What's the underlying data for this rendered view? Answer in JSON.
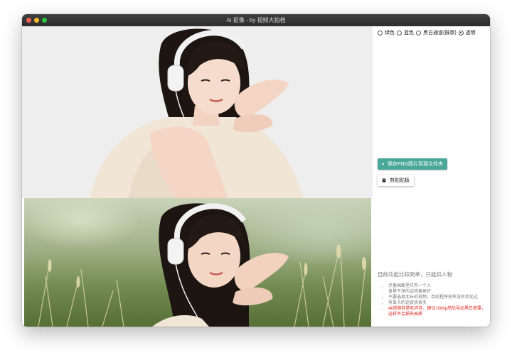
{
  "window": {
    "title": "Ai 抠像 - by 视频大拍档"
  },
  "options": {
    "background_choices": [
      {
        "label": "绿色",
        "selected": false
      },
      {
        "label": "蓝色",
        "selected": false
      },
      {
        "label": "黑白通道(推荐)",
        "selected": false
      },
      {
        "label": "透明",
        "selected": true
      }
    ]
  },
  "actions": {
    "save_png_label": "保存PNG图片到源文件夹",
    "save_icon": "floppy-disk-icon",
    "copy_label": "剪贴贴板",
    "copy_icon": "clipboard-icon"
  },
  "preview": {
    "top": "cutout-result-image",
    "bottom": "original-image"
  },
  "info": {
    "title": "目前功能比较简单，只能扣人物",
    "tips": [
      {
        "text": "尽量画面里只有一个人",
        "warn": false
      },
      {
        "text": "背景干净的话效果更好",
        "warn": false
      },
      {
        "text": "不要选择太长的视频，目前程序效率没有优化过",
        "warn": false
      },
      {
        "text": "有显卡的话会快很多",
        "warn": false
      },
      {
        "text": "4k视频非常吃内存，建议1080p然后导出黑白遮罩，这样不会损失画质",
        "warn": true
      }
    ]
  },
  "colors": {
    "accent": "#4aa89a",
    "warning": "#e0241b",
    "titlebar": "#333333"
  }
}
